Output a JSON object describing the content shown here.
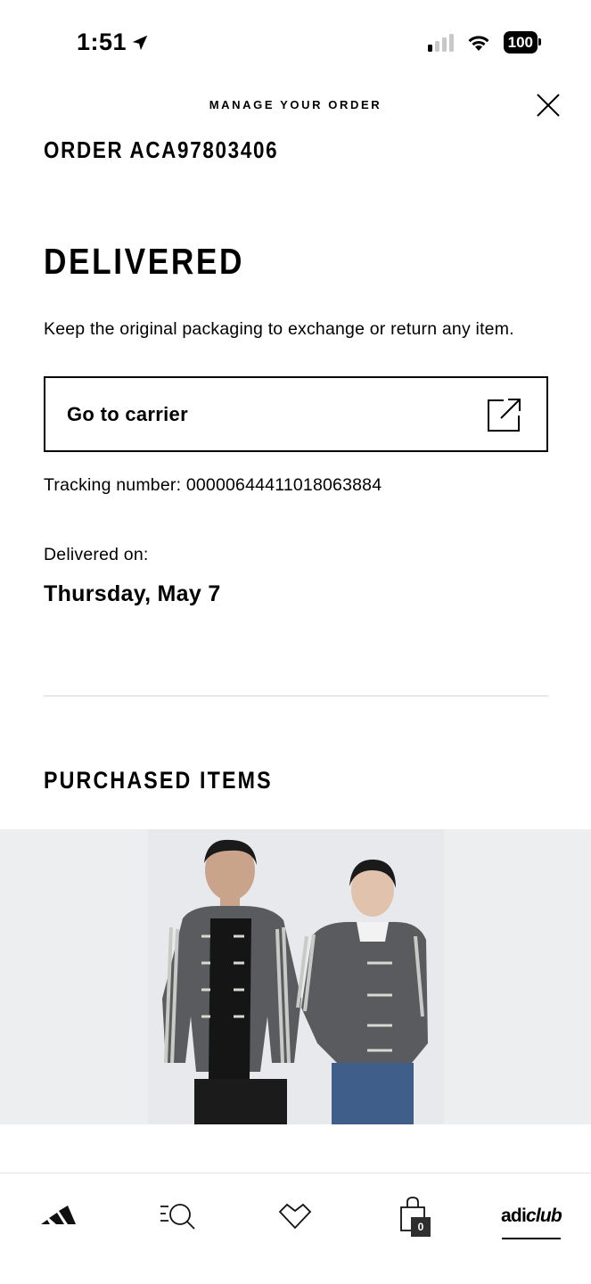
{
  "status_bar": {
    "time": "1:51",
    "battery": "100"
  },
  "header": {
    "title": "MANAGE YOUR ORDER",
    "order_id": "ORDER ACA97803406"
  },
  "delivery": {
    "status": "DELIVERED",
    "note": "Keep the original packaging to exchange or return any item.",
    "carrier_button": "Go to carrier",
    "tracking": "Tracking number: 00000644411018063884",
    "delivered_on_label": "Delivered on:",
    "delivered_on_date": "Thursday, May 7"
  },
  "purchased_items": {
    "title": "PURCHASED ITEMS"
  },
  "bottom_nav": {
    "bag_count": "0",
    "adiclub_prefix": "adi",
    "adiclub_suffix": "club"
  }
}
